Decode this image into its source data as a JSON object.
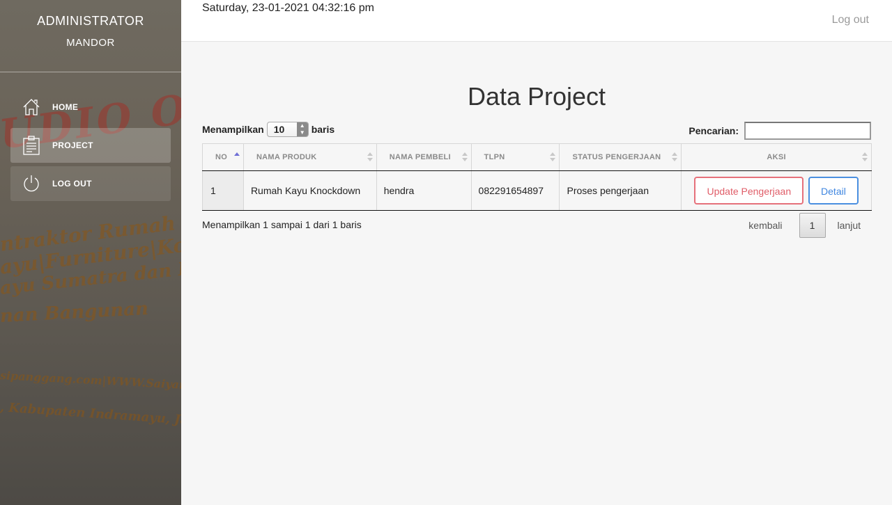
{
  "sidebar": {
    "role": "ADMINISTRATOR",
    "username": "MANDOR",
    "items": [
      {
        "label": "HOME",
        "icon": "home-icon"
      },
      {
        "label": "PROJECT",
        "icon": "clipboard-icon"
      },
      {
        "label": "LOG OUT",
        "icon": "power-icon"
      }
    ],
    "watermark": [
      "UDIO OPTI",
      "ntraktor Rumah Ka",
      "ayu|Furniture|Kontruksi",
      "ayu Sumatra dan Kalima",
      "nan Bangunan",
      "sipanggang.com|WWW.Saiyan-Kontr",
      ", Kabupaten Indramayu, Jawa Barat"
    ]
  },
  "header": {
    "datetime": "Saturday, 23-01-2021 04:32:16 pm",
    "logout_label": "Log out"
  },
  "main": {
    "title": "Data Project",
    "length_label_before": "Menampilkan",
    "length_value": "10",
    "length_label_after": "baris",
    "search_label": "Pencarian:",
    "search_value": "",
    "columns": [
      "NO",
      "NAMA PRODUK",
      "NAMA PEMBELI",
      "TLPN",
      "STATUS PENGERJAAN",
      "AKSI"
    ],
    "rows": [
      {
        "no": "1",
        "nama_produk": "Rumah Kayu Knockdown",
        "nama_pembeli": "hendra",
        "tlpn": "082291654897",
        "status": "Proses pengerjaan",
        "update_label": "Update Pengerjaan",
        "detail_label": "Detail"
      }
    ],
    "info": "Menampilkan 1 sampai 1 dari 1 baris",
    "pager": {
      "prev": "kembali",
      "current": "1",
      "next": "lanjut"
    }
  },
  "colors": {
    "update_button": "#e05d68",
    "detail_button": "#3f86e0",
    "sort_active": "#6f6fd6"
  }
}
